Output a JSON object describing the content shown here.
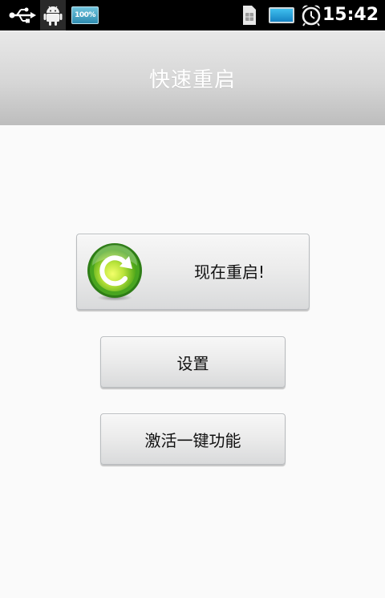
{
  "status_bar": {
    "usb_icon": "usb-icon",
    "android_icon": "android-icon",
    "battery_percent_label": "100%",
    "sim_icon": "sim-card-icon",
    "battery_icon": "battery-icon",
    "alarm_icon": "alarm-clock-icon",
    "time": "15:42"
  },
  "header": {
    "title": "快速重启"
  },
  "main": {
    "reboot_button": {
      "label": "现在重启!",
      "icon": "refresh-icon"
    },
    "settings_button": {
      "label": "设置"
    },
    "activate_button": {
      "label": "激活一键功能"
    }
  },
  "colors": {
    "status_bar_bg": "#000000",
    "title_bar_top": "#e8e8e8",
    "title_bar_bottom": "#bdbdbd",
    "page_bg": "#fafafa",
    "refresh_icon_green": "#2e8b1e",
    "battery_blue": "#2f9fd6"
  }
}
